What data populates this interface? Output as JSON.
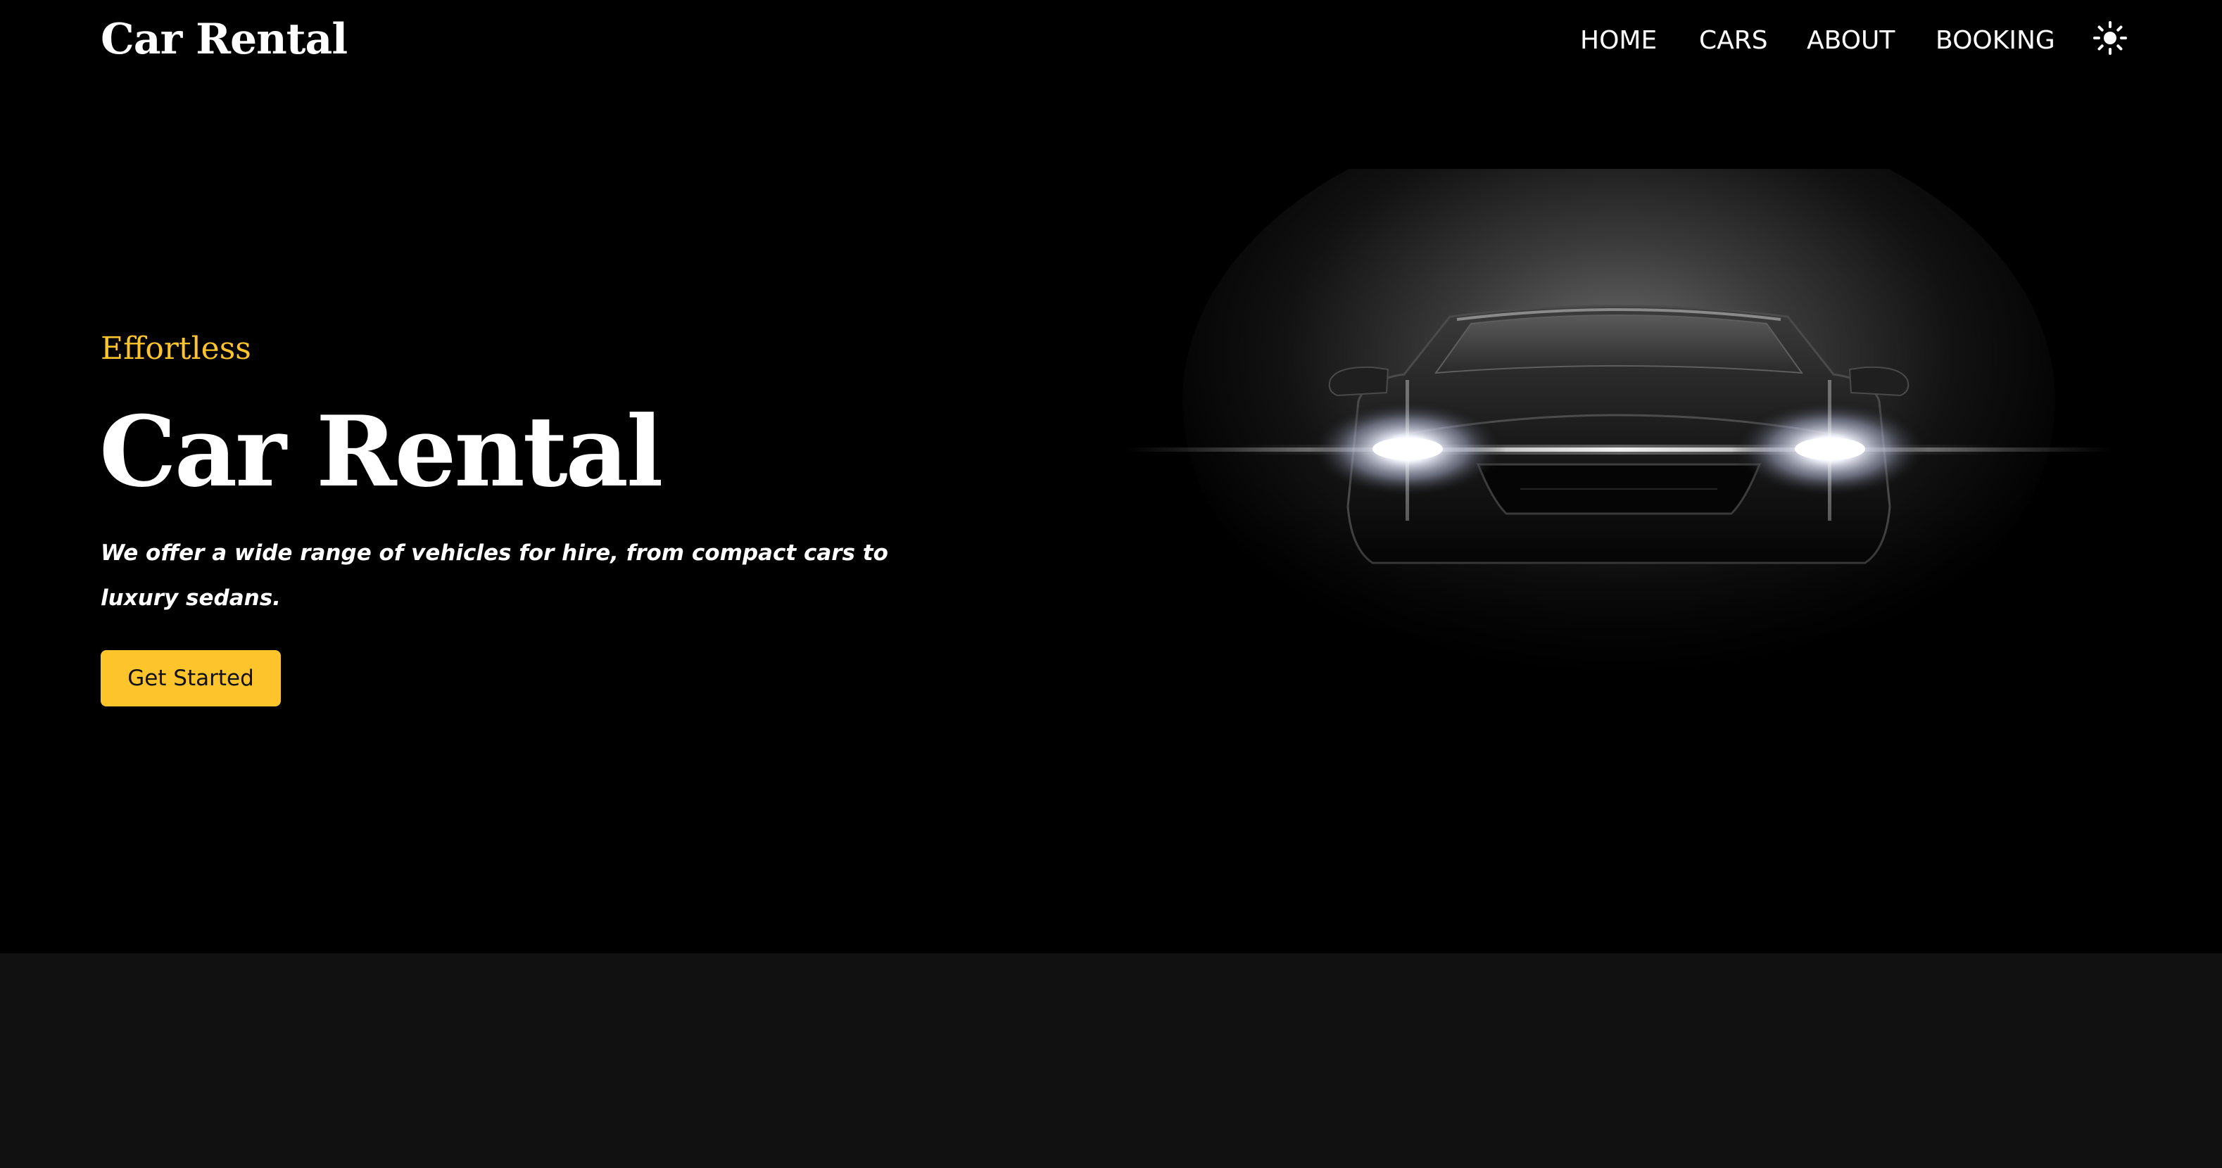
{
  "header": {
    "brand": "Car Rental",
    "nav": [
      "HOME",
      "CARS",
      "ABOUT",
      "BOOKING"
    ],
    "theme_icon": "sun-icon"
  },
  "hero": {
    "eyebrow": "Effortless",
    "title": "Car Rental",
    "description": "We offer a wide range of vehicles for hire, from compact cars to luxury sedans.",
    "cta_label": "Get Started",
    "image": "car-headlights-illustration"
  },
  "colors": {
    "background": "#000000",
    "accent": "#fdc42c",
    "text": "#ffffff",
    "lower_band": "#111111"
  }
}
